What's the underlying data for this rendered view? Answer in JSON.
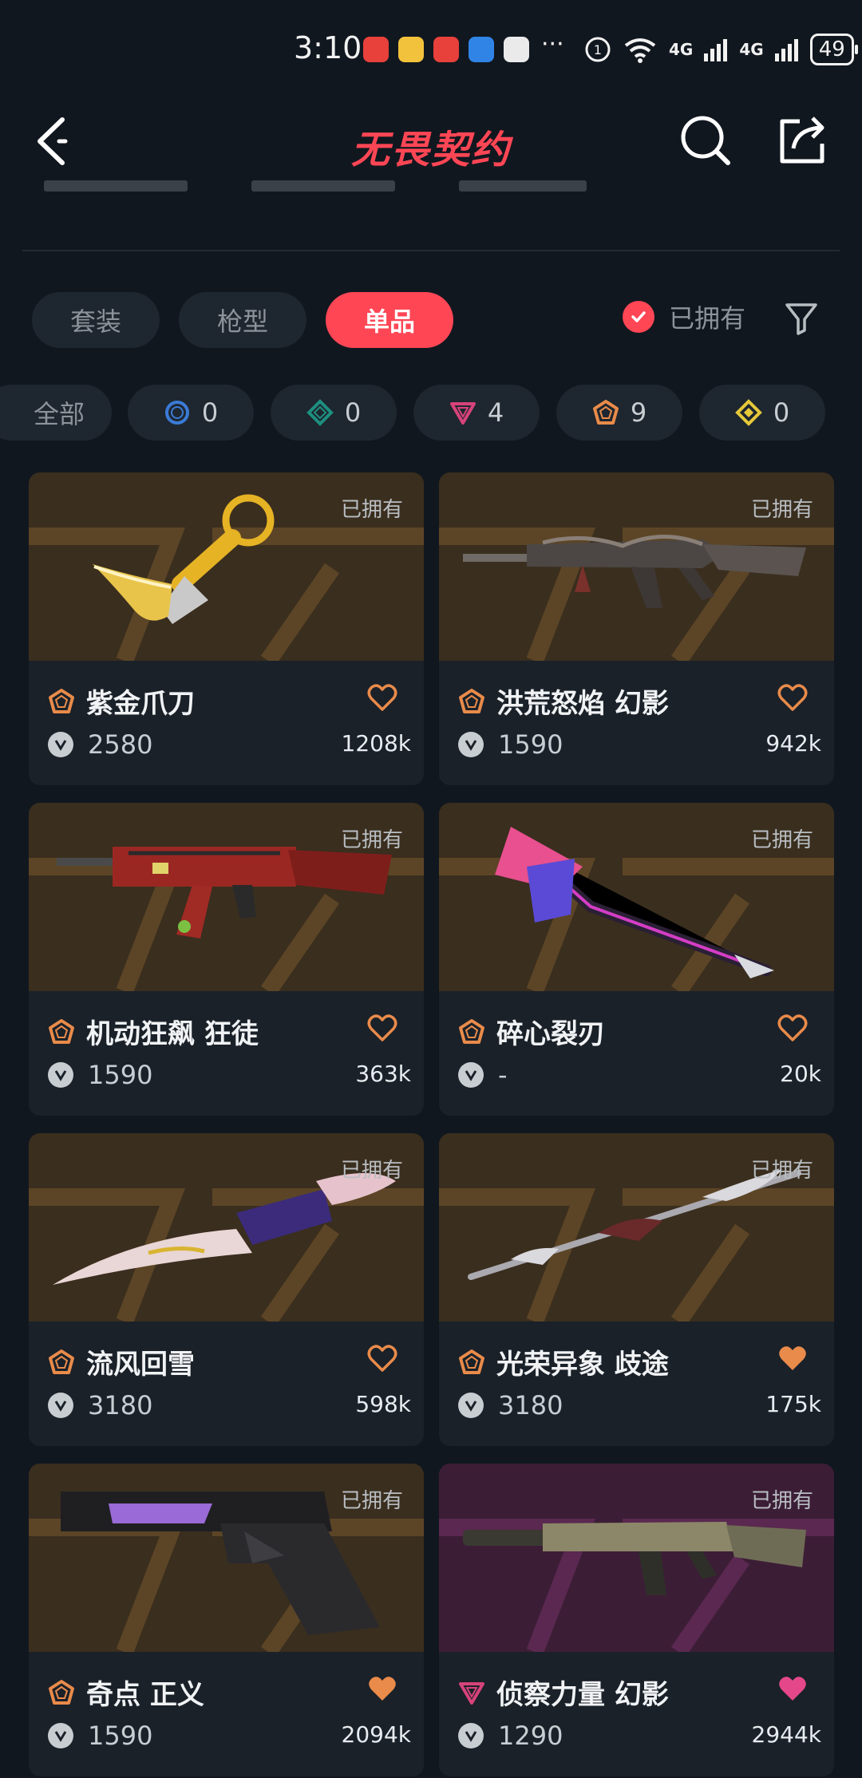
{
  "status_bar": {
    "time": "3:10",
    "battery": "49",
    "network_1": "4G",
    "network_2": "4G"
  },
  "header": {
    "title": "无畏契约"
  },
  "tabs": [
    {
      "label": "套装",
      "active": false
    },
    {
      "label": "枪型",
      "active": false
    },
    {
      "label": "单品",
      "active": true
    }
  ],
  "owned_filter": {
    "label": "已拥有",
    "checked": true
  },
  "rarity_chips": [
    {
      "label": "全部",
      "count": ""
    },
    {
      "label": "select",
      "count": "0",
      "color": "#3a7bd5"
    },
    {
      "label": "deluxe",
      "count": "0",
      "color": "#1d8f80"
    },
    {
      "label": "premium",
      "count": "4",
      "color": "#d6437a"
    },
    {
      "label": "exclusive",
      "count": "9",
      "color": "#e98b4a"
    },
    {
      "label": "ultra",
      "count": "0",
      "color": "#e6c93a"
    }
  ],
  "cards": [
    {
      "name": "紫金爪刀",
      "price": "2580",
      "likes": "1208k",
      "owned": "已拥有",
      "tier": "exclusive",
      "liked": false
    },
    {
      "name": "洪荒怒焰 幻影",
      "price": "1590",
      "likes": "942k",
      "owned": "已拥有",
      "tier": "exclusive",
      "liked": false
    },
    {
      "name": "机动狂飙 狂徒",
      "price": "1590",
      "likes": "363k",
      "owned": "已拥有",
      "tier": "exclusive",
      "liked": false
    },
    {
      "name": "碎心裂刃",
      "price": "-",
      "likes": "20k",
      "owned": "已拥有",
      "tier": "exclusive",
      "liked": false
    },
    {
      "name": "流风回雪",
      "price": "3180",
      "likes": "598k",
      "owned": "已拥有",
      "tier": "exclusive",
      "liked": false
    },
    {
      "name": "光荣异象 歧途",
      "price": "3180",
      "likes": "175k",
      "owned": "已拥有",
      "tier": "exclusive",
      "liked": true
    },
    {
      "name": "奇点 正义",
      "price": "1590",
      "likes": "2094k",
      "owned": "已拥有",
      "tier": "exclusive",
      "liked": true
    },
    {
      "name": "侦察力量 幻影",
      "price": "1290",
      "likes": "2944k",
      "owned": "已拥有",
      "tier": "premium",
      "liked": true
    }
  ],
  "colors": {
    "accent": "#ff4655",
    "exclusive": "#e98b4a",
    "premium": "#d6437a",
    "background": "#11171f"
  }
}
